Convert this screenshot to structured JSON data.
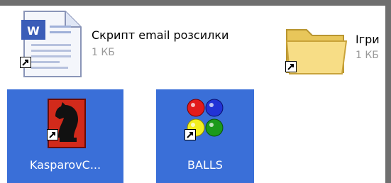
{
  "items": [
    {
      "name": "Скрипт  email розсилки",
      "size": "1 КБ",
      "icon": "word-document-icon",
      "shortcut": true
    },
    {
      "name": "Ігри",
      "size": "1 КБ",
      "icon": "folder-icon",
      "shortcut": true
    },
    {
      "name": "KasparovC...",
      "icon": "chess-knight-icon",
      "shortcut": true,
      "selected": true
    },
    {
      "name": "BALLS",
      "icon": "balls-icon",
      "shortcut": true,
      "selected": true
    }
  ],
  "colors": {
    "selection": "#3a6fd8",
    "frame": "#6f6f6f",
    "size_text": "#9a9a9a"
  }
}
